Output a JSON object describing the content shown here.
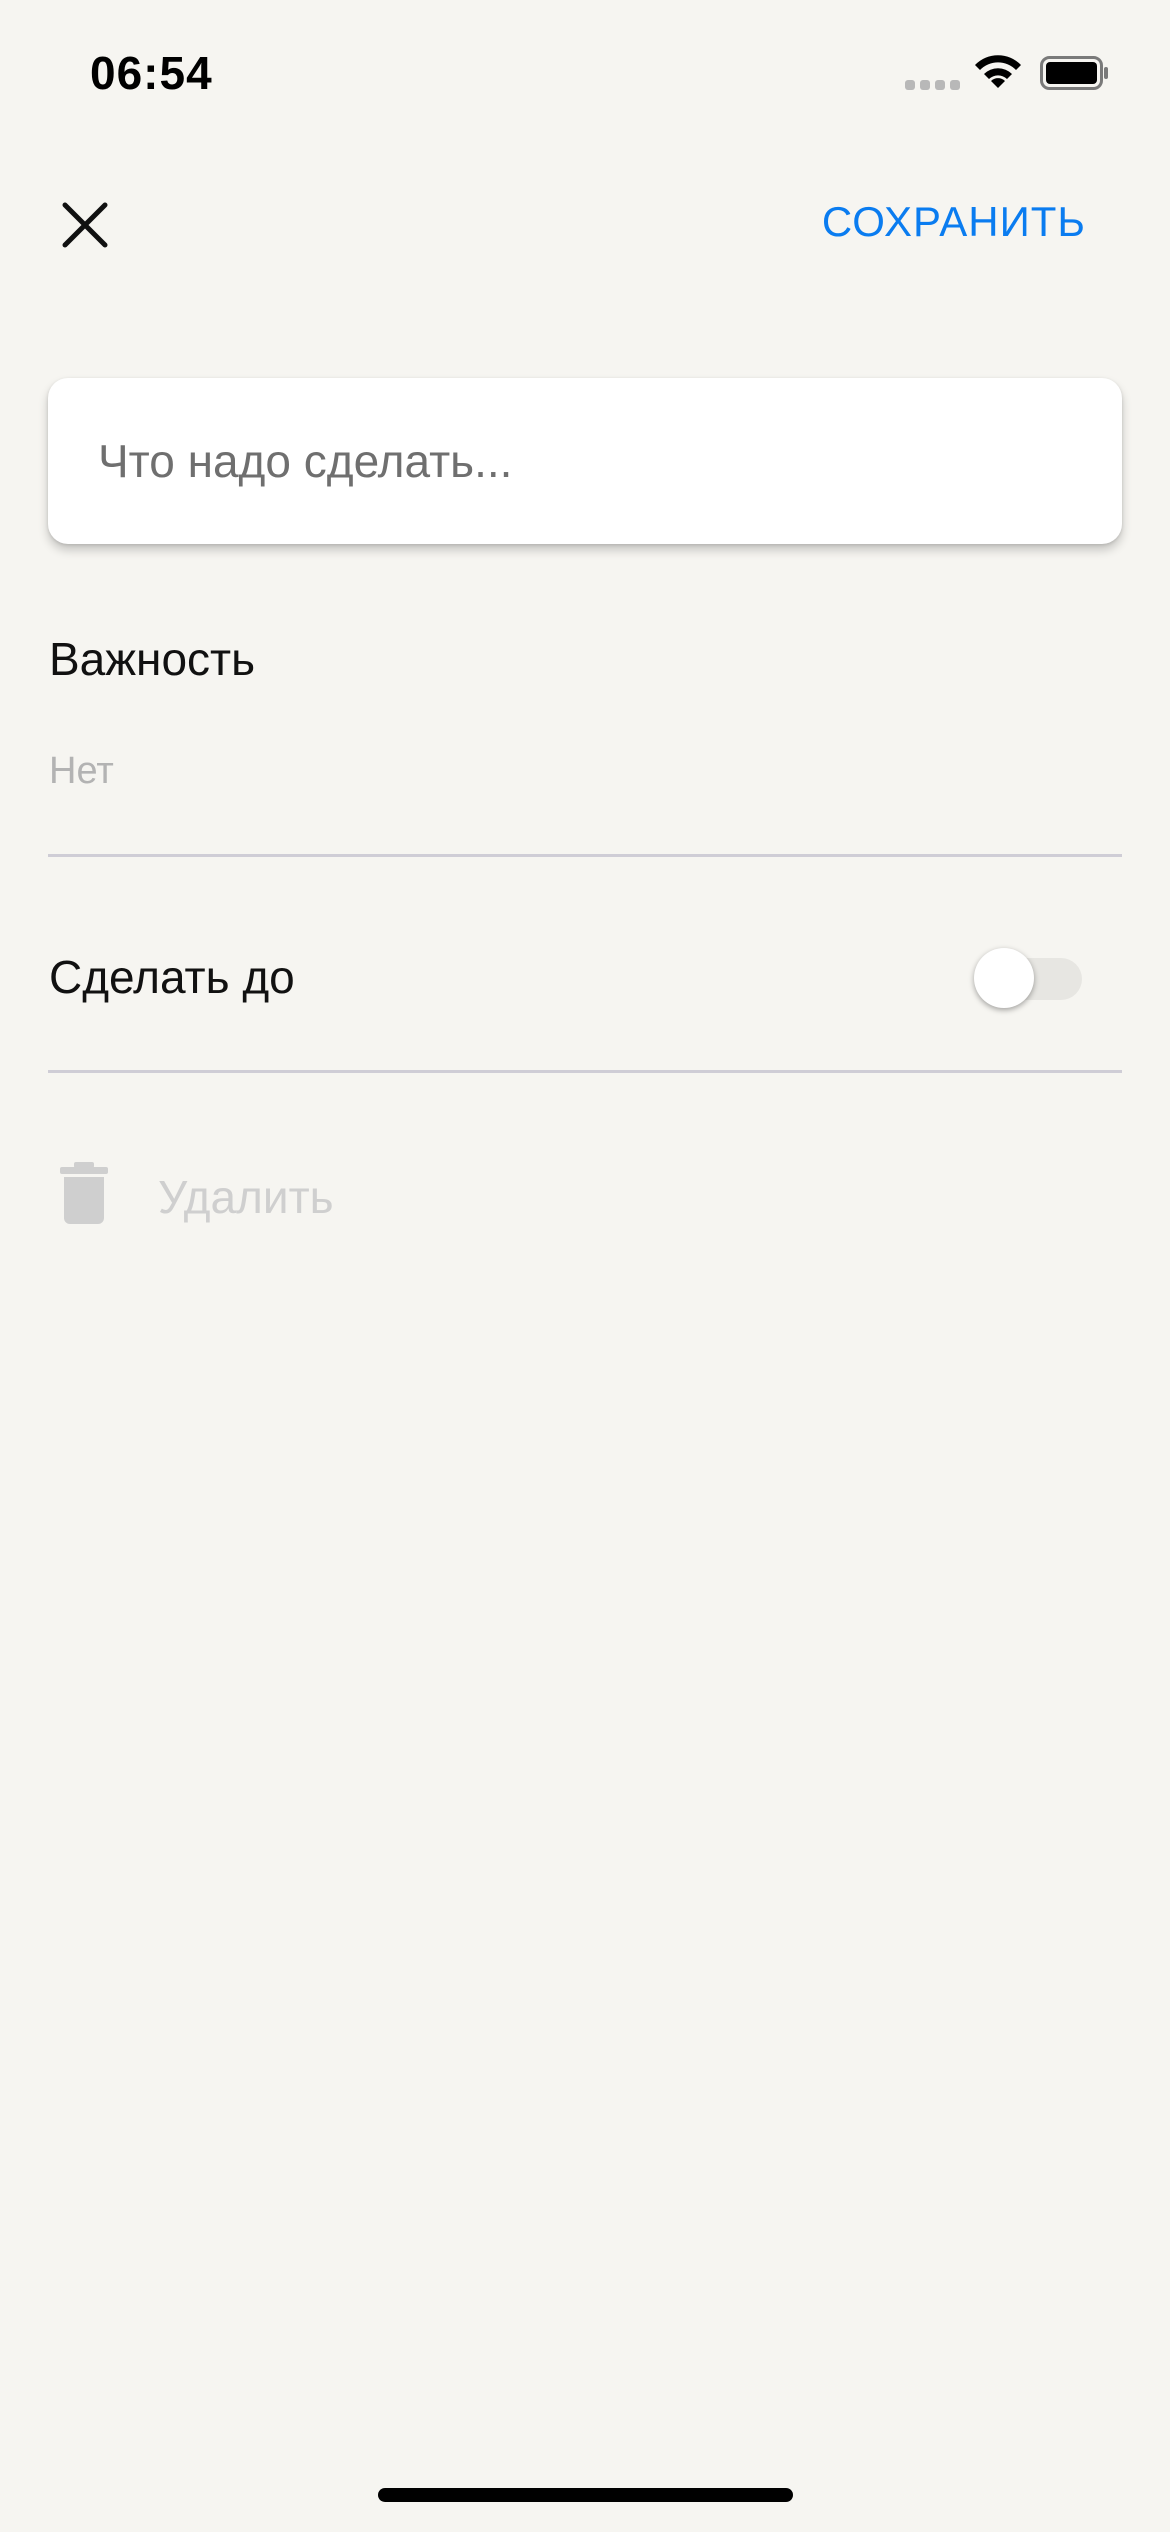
{
  "status_bar": {
    "time": "06:54"
  },
  "nav": {
    "save_label": "СОХРАНИТЬ",
    "save_color": "#0a7cf0"
  },
  "task": {
    "value": "",
    "placeholder": "Что надо сделать..."
  },
  "importance": {
    "label": "Важность",
    "value": "Нет"
  },
  "deadline": {
    "label": "Сделать до",
    "enabled": false
  },
  "delete": {
    "label": "Удалить",
    "disabled": true
  },
  "icons": {
    "close": "close-icon",
    "trash": "trash-icon",
    "wifi": "wifi-icon",
    "battery": "battery-icon",
    "signal": "signal-icon"
  }
}
